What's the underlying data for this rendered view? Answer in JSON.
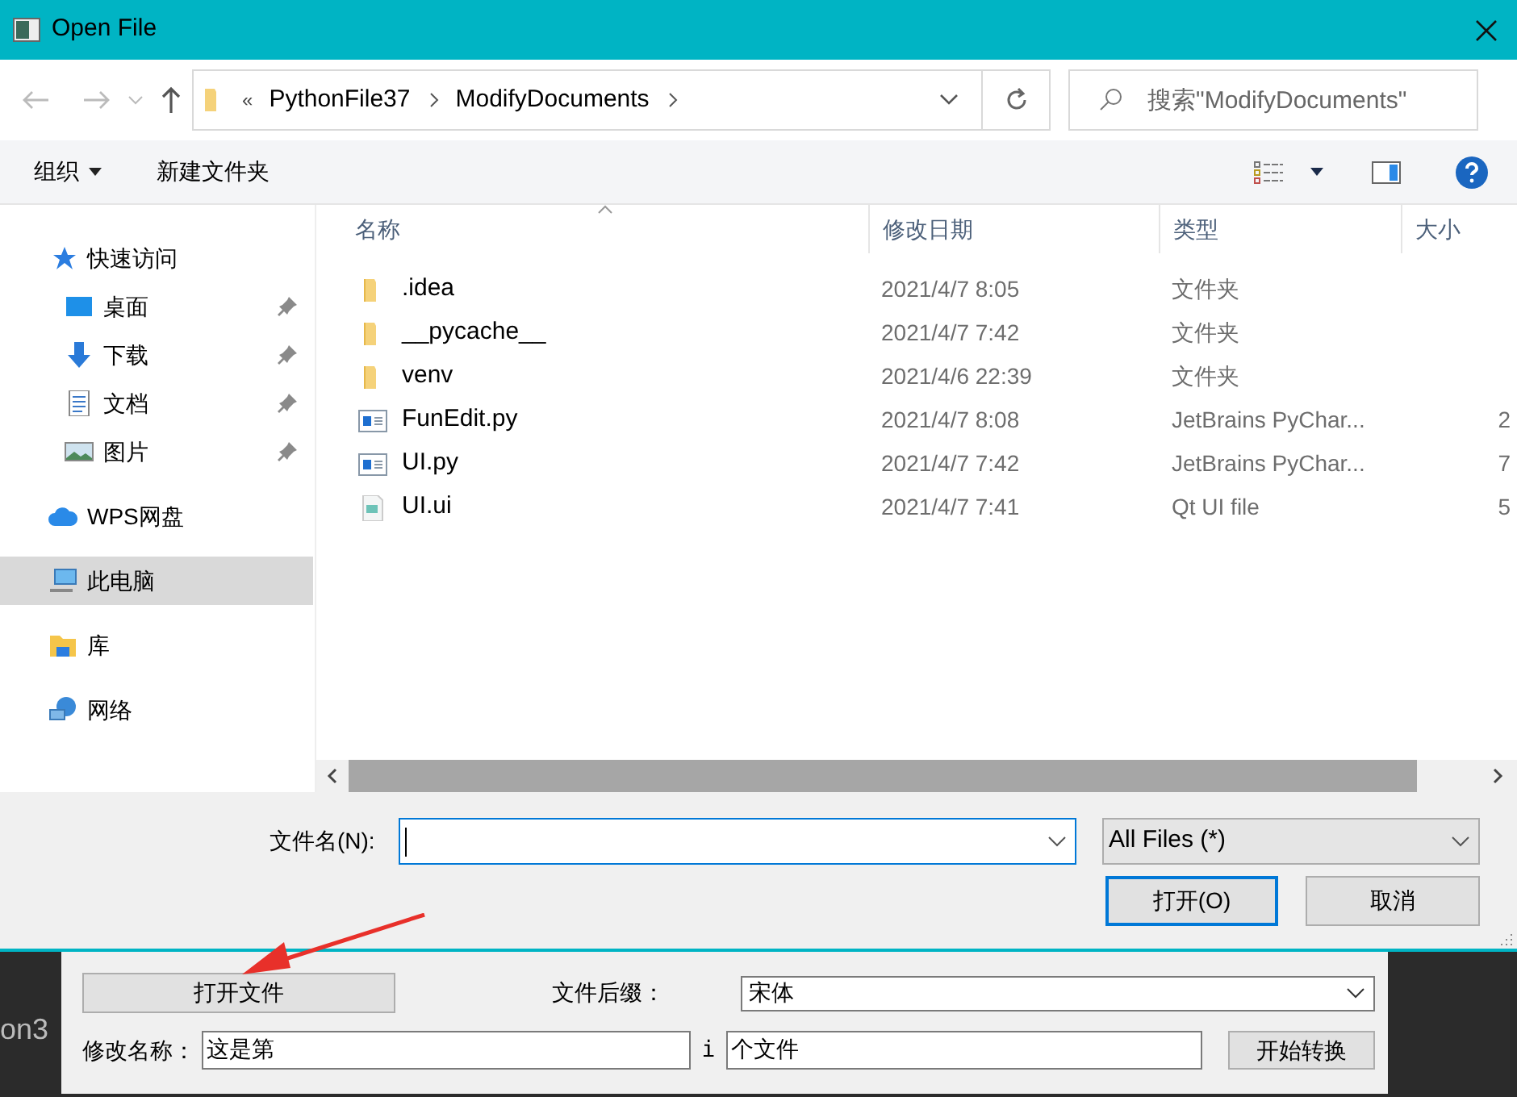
{
  "window": {
    "title": "Open File"
  },
  "nav": {
    "overflow": "«",
    "path": [
      "PythonFile37",
      "ModifyDocuments"
    ],
    "search_placeholder": "搜索\"ModifyDocuments\""
  },
  "toolbar": {
    "organize": "组织",
    "new_folder": "新建文件夹"
  },
  "sidebar": {
    "items": [
      {
        "label": "快速访问",
        "kind": "star",
        "selected": false,
        "children": [
          {
            "label": "桌面",
            "kind": "desktop",
            "selected": false,
            "pinned": true
          },
          {
            "label": "下载",
            "kind": "download",
            "selected": false,
            "pinned": true
          },
          {
            "label": "文档",
            "kind": "document",
            "selected": false,
            "pinned": true
          },
          {
            "label": "图片",
            "kind": "pictures",
            "selected": false,
            "pinned": true
          }
        ]
      },
      {
        "label": "WPS网盘",
        "kind": "cloud",
        "selected": false
      },
      {
        "label": "此电脑",
        "kind": "computer",
        "selected": true
      },
      {
        "label": "库",
        "kind": "library",
        "selected": false
      },
      {
        "label": "网络",
        "kind": "network",
        "selected": false
      }
    ]
  },
  "table": {
    "columns": [
      "名称",
      "修改日期",
      "类型",
      "大小"
    ],
    "rows": [
      {
        "name": ".idea",
        "date": "2021/4/7 8:05",
        "type": "文件夹",
        "kind": "folder"
      },
      {
        "name": "__pycache__",
        "date": "2021/4/7 7:42",
        "type": "文件夹",
        "kind": "folder"
      },
      {
        "name": "venv",
        "date": "2021/4/6 22:39",
        "type": "文件夹",
        "kind": "folder"
      },
      {
        "name": "FunEdit.py",
        "date": "2021/4/7 8:08",
        "type": "JetBrains PyChar...",
        "size": "2",
        "kind": "python"
      },
      {
        "name": "UI.py",
        "date": "2021/4/7 7:42",
        "type": "JetBrains PyChar...",
        "size": "7",
        "kind": "python"
      },
      {
        "name": "UI.ui",
        "date": "2021/4/7 7:41",
        "type": "Qt UI file",
        "size": "5",
        "kind": "ui"
      }
    ]
  },
  "footer": {
    "file_name_label": "文件名(N):",
    "filter": "All Files (*)",
    "open": "打开(O)",
    "cancel": "取消"
  },
  "background_app": {
    "editor_text": "on3",
    "open_button": "打开文件",
    "suffix_label": "文件后缀：",
    "suffix_value": "宋体",
    "rename_label": "修改名称：",
    "rename_prefix": "这是第",
    "index_label": "i",
    "rename_suffix": "个文件",
    "convert": "开始转换"
  }
}
